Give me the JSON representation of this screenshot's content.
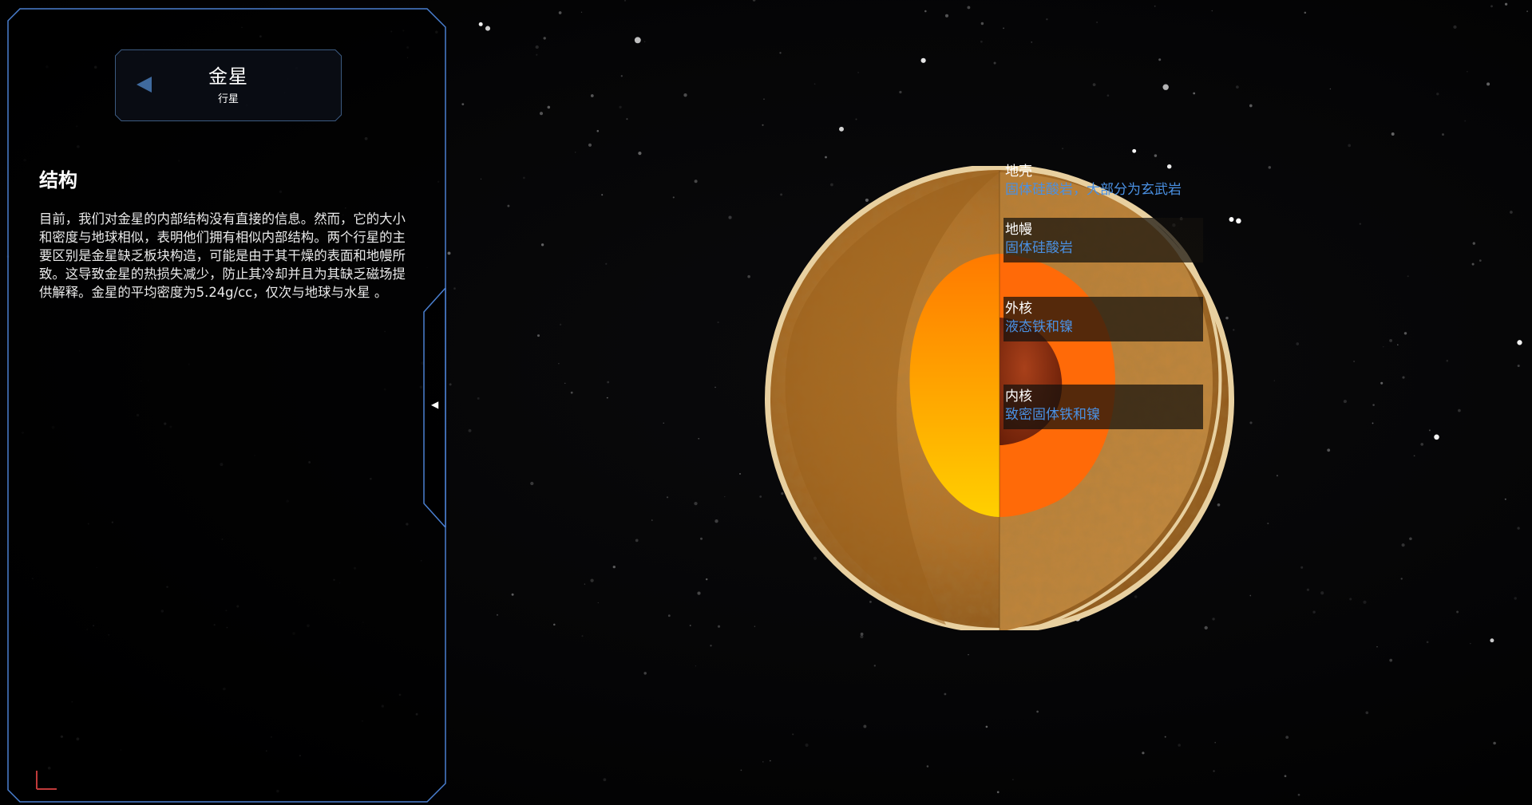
{
  "planet": {
    "name": "金星",
    "type": "行星"
  },
  "section": {
    "title": "结构",
    "body": "目前，我们对金星的内部结构没有直接的信息。然而，它的大小和密度与地球相似，表明他们拥有相似内部结构。两个行星的主要区别是金星缺乏板块构造，可能是由于其干燥的表面和地幔所致。这导致金星的热损失减少，防止其冷却并且为其缺乏磁场提供解释。金星的平均密度为5.24g/cc，仅次与地球与水星 。"
  },
  "layers": [
    {
      "name": "地壳",
      "desc": "固体硅酸岩，大部分为玄武岩"
    },
    {
      "name": "地幔",
      "desc": "固体硅酸岩"
    },
    {
      "name": "外核",
      "desc": "液态铁和镍"
    },
    {
      "name": "内核",
      "desc": "致密固体铁和镍"
    }
  ],
  "colors": {
    "panel_border": "#4a7fd0",
    "label_desc": "#4a90e2",
    "crust": "#e8d0a0",
    "mantle": "#b87a2a",
    "outer_core": "#ff7a10",
    "inner_core": "#8a2a0c"
  },
  "icons": {
    "back": "back-triangle-icon",
    "collapse": "collapse-arrow-icon",
    "axes": "axes-icon"
  }
}
